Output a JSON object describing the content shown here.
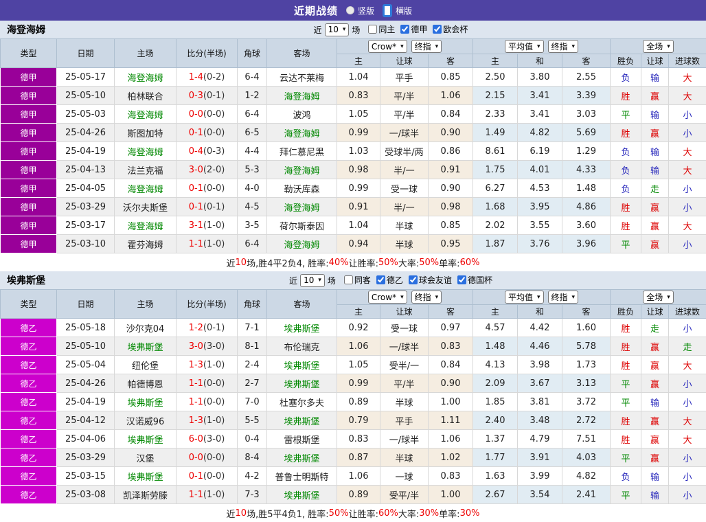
{
  "topbar": {
    "title": "近期战绩",
    "options": [
      {
        "label": "竖版",
        "selected": false
      },
      {
        "label": "横版",
        "selected": true
      }
    ]
  },
  "colors": {
    "topbar_bg": "#4f43a3",
    "header_bg": "#ccd8e5",
    "subject_team_green": "#008800",
    "score_red": "#ee0000",
    "win_red": "#dd0000",
    "draw_green": "#008800",
    "lose_blue": "#2626bb"
  },
  "type_colors": {
    "德甲": "#990099",
    "德乙": "#cc00cc"
  },
  "result_color_map": {
    "胜": "red",
    "平": "green",
    "负": "blue",
    "赢": "red",
    "走": "green",
    "输": "blue",
    "大": "red",
    "小": "blue"
  },
  "table_header": {
    "columns": [
      "类型",
      "日期",
      "主场",
      "比分(半场)",
      "角球",
      "客场"
    ],
    "sub_columns": [
      "主",
      "让球",
      "客",
      "主",
      "和",
      "客",
      "胜负",
      "让球",
      "进球数"
    ],
    "selects": {
      "bookmaker": "Crow*",
      "final1": "终指",
      "average": "平均值",
      "final2": "终指",
      "scope": "全场"
    }
  },
  "sections": [
    {
      "name": "海登海姆",
      "filters": {
        "near_label": "近",
        "count": "10",
        "games_label": "场",
        "checks": [
          {
            "label": "同主",
            "checked": false
          },
          {
            "label": "德甲",
            "checked": true
          },
          {
            "label": "欧会杯",
            "checked": true
          }
        ]
      },
      "rows": [
        {
          "type": "德甲",
          "date": "25-05-17",
          "home": "海登海姆",
          "home_subject": true,
          "score": "1-4",
          "half": "0-2",
          "corner": "6-4",
          "away": "云达不莱梅",
          "away_subject": false,
          "odds": [
            "1.04",
            "平手",
            "0.85"
          ],
          "avg": [
            "2.50",
            "3.80",
            "2.55"
          ],
          "results": [
            "负",
            "输",
            "大"
          ]
        },
        {
          "type": "德甲",
          "date": "25-05-10",
          "home": "柏林联合",
          "home_subject": false,
          "score": "0-3",
          "half": "0-1",
          "corner": "1-2",
          "away": "海登海姆",
          "away_subject": true,
          "odds": [
            "0.83",
            "平/半",
            "1.06"
          ],
          "avg": [
            "2.15",
            "3.41",
            "3.39"
          ],
          "results": [
            "胜",
            "赢",
            "大"
          ]
        },
        {
          "type": "德甲",
          "date": "25-05-03",
          "home": "海登海姆",
          "home_subject": true,
          "score": "0-0",
          "half": "0-0",
          "corner": "6-4",
          "away": "波鸿",
          "away_subject": false,
          "odds": [
            "1.05",
            "平/半",
            "0.84"
          ],
          "avg": [
            "2.33",
            "3.41",
            "3.03"
          ],
          "results": [
            "平",
            "输",
            "小"
          ]
        },
        {
          "type": "德甲",
          "date": "25-04-26",
          "home": "斯图加特",
          "home_subject": false,
          "score": "0-1",
          "half": "0-0",
          "corner": "6-5",
          "away": "海登海姆",
          "away_subject": true,
          "odds": [
            "0.99",
            "一/球半",
            "0.90"
          ],
          "avg": [
            "1.49",
            "4.82",
            "5.69"
          ],
          "results": [
            "胜",
            "赢",
            "小"
          ]
        },
        {
          "type": "德甲",
          "date": "25-04-19",
          "home": "海登海姆",
          "home_subject": true,
          "score": "0-4",
          "half": "0-3",
          "corner": "4-4",
          "away": "拜仁慕尼黑",
          "away_subject": false,
          "odds": [
            "1.03",
            "受球半/两",
            "0.86"
          ],
          "avg": [
            "8.61",
            "6.19",
            "1.29"
          ],
          "results": [
            "负",
            "输",
            "大"
          ]
        },
        {
          "type": "德甲",
          "date": "25-04-13",
          "home": "法兰克福",
          "home_subject": false,
          "score": "3-0",
          "half": "2-0",
          "corner": "5-3",
          "away": "海登海姆",
          "away_subject": true,
          "odds": [
            "0.98",
            "半/一",
            "0.91"
          ],
          "avg": [
            "1.75",
            "4.01",
            "4.33"
          ],
          "results": [
            "负",
            "输",
            "大"
          ]
        },
        {
          "type": "德甲",
          "date": "25-04-05",
          "home": "海登海姆",
          "home_subject": true,
          "score": "0-1",
          "half": "0-0",
          "corner": "4-0",
          "away": "勒沃库森",
          "away_subject": false,
          "odds": [
            "0.99",
            "受一球",
            "0.90"
          ],
          "avg": [
            "6.27",
            "4.53",
            "1.48"
          ],
          "results": [
            "负",
            "走",
            "小"
          ]
        },
        {
          "type": "德甲",
          "date": "25-03-29",
          "home": "沃尔夫斯堡",
          "home_subject": false,
          "score": "0-1",
          "half": "0-1",
          "corner": "4-5",
          "away": "海登海姆",
          "away_subject": true,
          "odds": [
            "0.91",
            "半/一",
            "0.98"
          ],
          "avg": [
            "1.68",
            "3.95",
            "4.86"
          ],
          "results": [
            "胜",
            "赢",
            "小"
          ]
        },
        {
          "type": "德甲",
          "date": "25-03-17",
          "home": "海登海姆",
          "home_subject": true,
          "score": "3-1",
          "half": "1-0",
          "corner": "3-5",
          "away": "荷尔斯泰因",
          "away_subject": false,
          "odds": [
            "1.04",
            "半球",
            "0.85"
          ],
          "avg": [
            "2.02",
            "3.55",
            "3.60"
          ],
          "results": [
            "胜",
            "赢",
            "大"
          ]
        },
        {
          "type": "德甲",
          "date": "25-03-10",
          "home": "霍芬海姆",
          "home_subject": false,
          "score": "1-1",
          "half": "1-0",
          "corner": "6-4",
          "away": "海登海姆",
          "away_subject": true,
          "odds": [
            "0.94",
            "半球",
            "0.95"
          ],
          "avg": [
            "1.87",
            "3.76",
            "3.96"
          ],
          "results": [
            "平",
            "赢",
            "小"
          ]
        }
      ],
      "summary": [
        {
          "text": "近"
        },
        {
          "text": "10",
          "red": true
        },
        {
          "text": "场,胜4平2负4, 胜率:"
        },
        {
          "text": "40%",
          "red": true
        },
        {
          "text": " 让胜率:"
        },
        {
          "text": "50%",
          "red": true
        },
        {
          "text": " 大率:"
        },
        {
          "text": "50%",
          "red": true
        },
        {
          "text": " 单率:"
        },
        {
          "text": "60%",
          "red": true
        }
      ]
    },
    {
      "name": "埃弗斯堡",
      "filters": {
        "near_label": "近",
        "count": "10",
        "games_label": "场",
        "checks": [
          {
            "label": "同客",
            "checked": false
          },
          {
            "label": "德乙",
            "checked": true
          },
          {
            "label": "球会友谊",
            "checked": true
          },
          {
            "label": "德国杯",
            "checked": true
          }
        ]
      },
      "rows": [
        {
          "type": "德乙",
          "date": "25-05-18",
          "home": "沙尔克04",
          "home_subject": false,
          "score": "1-2",
          "half": "0-1",
          "corner": "7-1",
          "away": "埃弗斯堡",
          "away_subject": true,
          "odds": [
            "0.92",
            "受一球",
            "0.97"
          ],
          "avg": [
            "4.57",
            "4.42",
            "1.60"
          ],
          "results": [
            "胜",
            "走",
            "小"
          ]
        },
        {
          "type": "德乙",
          "date": "25-05-10",
          "home": "埃弗斯堡",
          "home_subject": true,
          "score": "3-0",
          "half": "3-0",
          "corner": "8-1",
          "away": "布伦瑞克",
          "away_subject": false,
          "odds": [
            "1.06",
            "一/球半",
            "0.83"
          ],
          "avg": [
            "1.48",
            "4.46",
            "5.78"
          ],
          "results": [
            "胜",
            "赢",
            "走"
          ]
        },
        {
          "type": "德乙",
          "date": "25-05-04",
          "home": "纽伦堡",
          "home_subject": false,
          "score": "1-3",
          "half": "1-0",
          "corner": "2-4",
          "away": "埃弗斯堡",
          "away_subject": true,
          "odds": [
            "1.05",
            "受半/一",
            "0.84"
          ],
          "avg": [
            "4.13",
            "3.98",
            "1.73"
          ],
          "results": [
            "胜",
            "赢",
            "大"
          ]
        },
        {
          "type": "德乙",
          "date": "25-04-26",
          "home": "帕德博恩",
          "home_subject": false,
          "score": "1-1",
          "half": "0-0",
          "corner": "2-7",
          "away": "埃弗斯堡",
          "away_subject": true,
          "odds": [
            "0.99",
            "平/半",
            "0.90"
          ],
          "avg": [
            "2.09",
            "3.67",
            "3.13"
          ],
          "results": [
            "平",
            "赢",
            "小"
          ]
        },
        {
          "type": "德乙",
          "date": "25-04-19",
          "home": "埃弗斯堡",
          "home_subject": true,
          "score": "1-1",
          "half": "0-0",
          "corner": "7-0",
          "away": "杜塞尔多夫",
          "away_subject": false,
          "odds": [
            "0.89",
            "半球",
            "1.00"
          ],
          "avg": [
            "1.85",
            "3.81",
            "3.72"
          ],
          "results": [
            "平",
            "输",
            "小"
          ]
        },
        {
          "type": "德乙",
          "date": "25-04-12",
          "home": "汉诺威96",
          "home_subject": false,
          "score": "1-3",
          "half": "1-0",
          "corner": "5-5",
          "away": "埃弗斯堡",
          "away_subject": true,
          "odds": [
            "0.79",
            "平手",
            "1.11"
          ],
          "avg": [
            "2.40",
            "3.48",
            "2.72"
          ],
          "results": [
            "胜",
            "赢",
            "大"
          ]
        },
        {
          "type": "德乙",
          "date": "25-04-06",
          "home": "埃弗斯堡",
          "home_subject": true,
          "score": "6-0",
          "half": "3-0",
          "corner": "0-4",
          "away": "雷根斯堡",
          "away_subject": false,
          "odds": [
            "0.83",
            "一/球半",
            "1.06"
          ],
          "avg": [
            "1.37",
            "4.79",
            "7.51"
          ],
          "results": [
            "胜",
            "赢",
            "大"
          ]
        },
        {
          "type": "德乙",
          "date": "25-03-29",
          "home": "汉堡",
          "home_subject": false,
          "score": "0-0",
          "half": "0-0",
          "corner": "8-4",
          "away": "埃弗斯堡",
          "away_subject": true,
          "odds": [
            "0.87",
            "半球",
            "1.02"
          ],
          "avg": [
            "1.77",
            "3.91",
            "4.03"
          ],
          "results": [
            "平",
            "赢",
            "小"
          ]
        },
        {
          "type": "德乙",
          "date": "25-03-15",
          "home": "埃弗斯堡",
          "home_subject": true,
          "score": "0-1",
          "half": "0-0",
          "corner": "4-2",
          "away": "普鲁士明斯特",
          "away_subject": false,
          "odds": [
            "1.06",
            "一球",
            "0.83"
          ],
          "avg": [
            "1.63",
            "3.99",
            "4.82"
          ],
          "results": [
            "负",
            "输",
            "小"
          ]
        },
        {
          "type": "德乙",
          "date": "25-03-08",
          "home": "凯泽斯劳滕",
          "home_subject": false,
          "score": "1-1",
          "half": "1-0",
          "corner": "7-3",
          "away": "埃弗斯堡",
          "away_subject": true,
          "odds": [
            "0.89",
            "受平/半",
            "1.00"
          ],
          "avg": [
            "2.67",
            "3.54",
            "2.41"
          ],
          "results": [
            "平",
            "输",
            "小"
          ]
        }
      ],
      "summary": [
        {
          "text": "近"
        },
        {
          "text": "10",
          "red": true
        },
        {
          "text": "场,胜5平4负1, 胜率:"
        },
        {
          "text": "50%",
          "red": true
        },
        {
          "text": " 让胜率:"
        },
        {
          "text": "60%",
          "red": true
        },
        {
          "text": " 大率:"
        },
        {
          "text": "30%",
          "red": true
        },
        {
          "text": " 单率:"
        },
        {
          "text": "30%",
          "red": true
        }
      ]
    }
  ]
}
